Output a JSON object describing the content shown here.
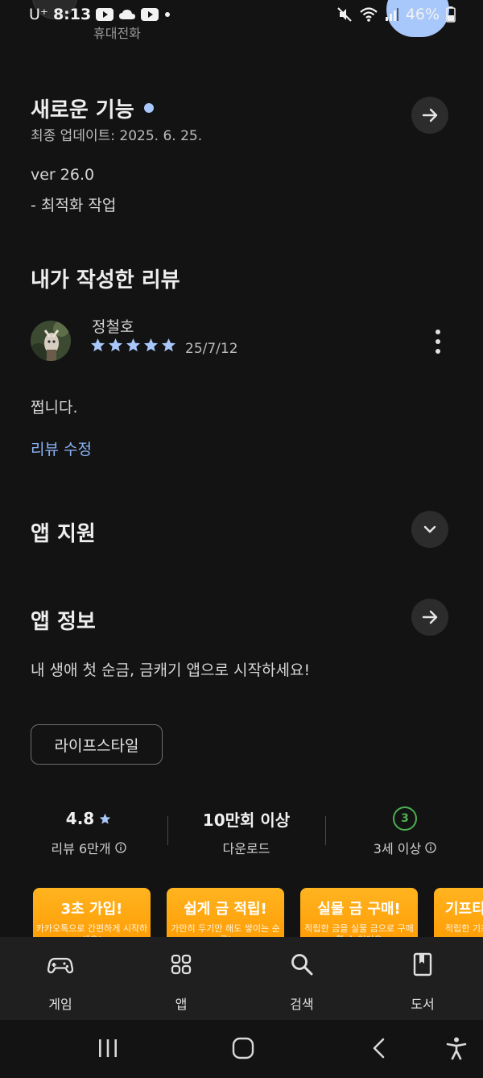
{
  "status_bar": {
    "carrier": "U⁺",
    "time": "8:13",
    "battery": "46%"
  },
  "peek": {
    "text": "휴대전화"
  },
  "whats_new": {
    "title": "새로운 기능",
    "updated": "최종 업데이트: 2025. 6. 25.",
    "version": "ver 26.0",
    "note": "- 최적화 작업"
  },
  "my_review": {
    "title": "내가 작성한 리뷰",
    "reviewer": "정철호",
    "rating": 5,
    "date": "25/7/12",
    "text": "쩝니다.",
    "edit_link": "리뷰 수정"
  },
  "app_support": {
    "title": "앱 지원"
  },
  "app_info": {
    "title": "앱 정보",
    "description": "내 생애 첫 순금, 금캐기 앱으로 시작하세요!",
    "category": "라이프스타일"
  },
  "stats": {
    "rating": "4.8",
    "reviews": "리뷰 6만개",
    "downloads": "10만회 이상",
    "downloads_label": "다운로드",
    "age_badge": "3",
    "age_label": "3세 이상"
  },
  "promos": [
    {
      "title": "3초 가입!",
      "sub": "카카오톡으로 간편하게 시작하세요!"
    },
    {
      "title": "쉽게 금 적립!",
      "sub": "가만히 두기만 해도 쌓이는 순금!"
    },
    {
      "title": "실물 금 구매!",
      "sub": "적립한 금을 실물 금으로 구매 할 수 있어요"
    },
    {
      "title": "기프티",
      "sub": "적립한 기프티콘"
    }
  ],
  "bottom_nav": {
    "items": [
      {
        "label": "게임",
        "icon": "gamepad-icon"
      },
      {
        "label": "앱",
        "icon": "apps-grid-icon"
      },
      {
        "label": "검색",
        "icon": "search-icon"
      },
      {
        "label": "도서",
        "icon": "book-icon"
      }
    ]
  },
  "colors": {
    "background": "#131313",
    "accent": "#a8c7fa",
    "link": "#8ab4f8",
    "age_badge": "#4caf50",
    "promo": "#ff9800"
  }
}
